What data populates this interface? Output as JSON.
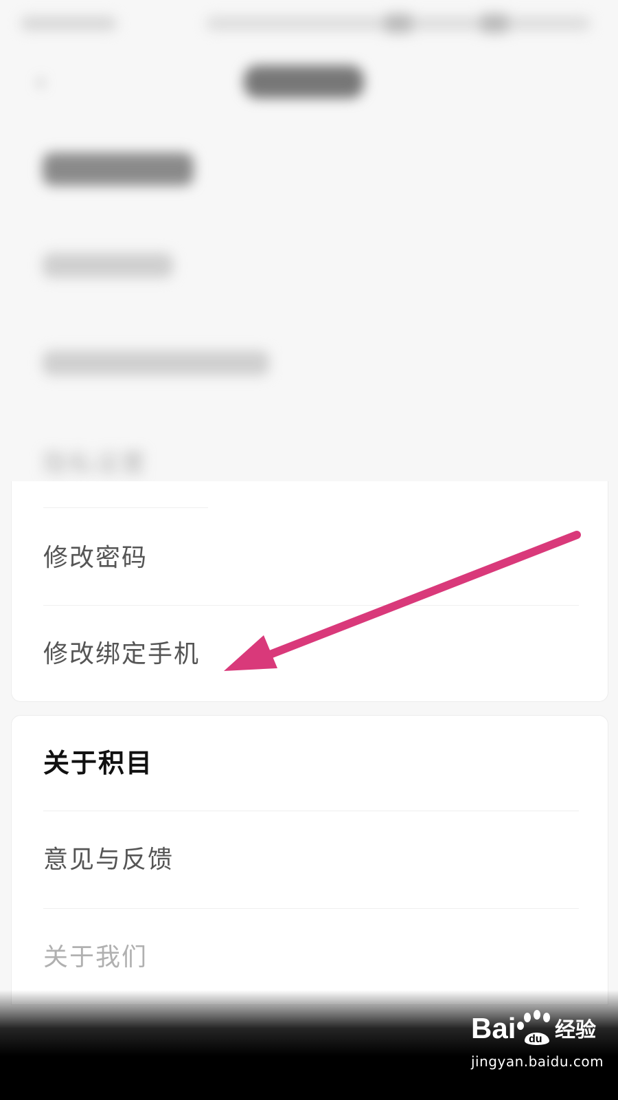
{
  "account_rows": {
    "privacy_label": "隐私设置",
    "change_password": "修改密码",
    "change_bound_phone": "修改绑定手机"
  },
  "about_section": {
    "title": "关于积目",
    "feedback": "意见与反馈",
    "about_us": "关于我们"
  },
  "watermark": {
    "brand": "Baidu经验",
    "url": "jingyan.baidu.com"
  },
  "colors": {
    "arrow": "#d9397a",
    "text_primary": "#111111",
    "text_secondary": "#555555"
  }
}
